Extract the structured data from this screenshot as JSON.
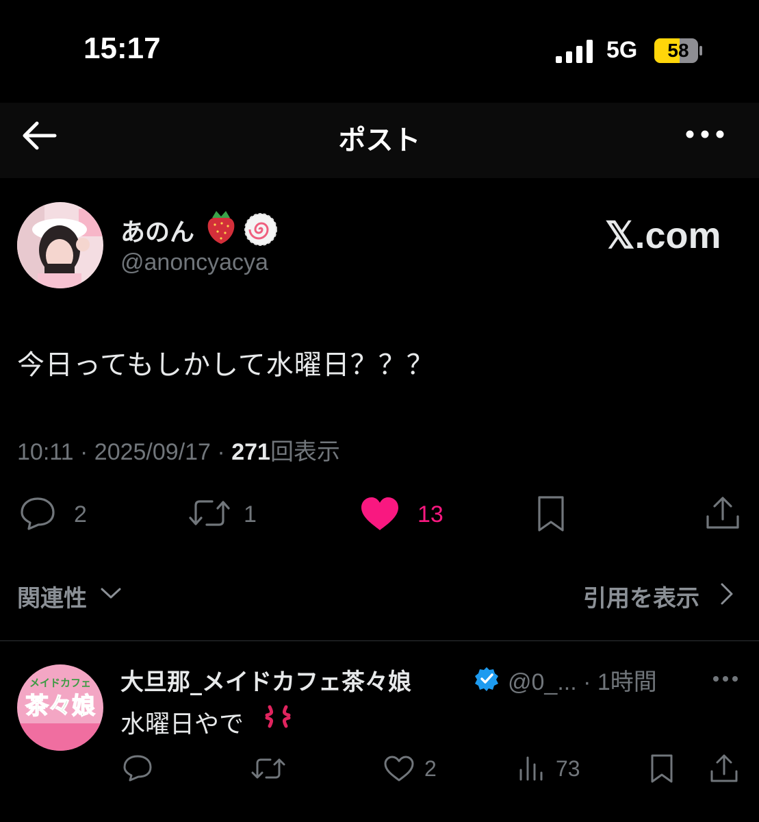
{
  "status": {
    "time": "15:17",
    "network": "5G",
    "battery": "58"
  },
  "nav": {
    "title": "ポスト"
  },
  "post": {
    "author_name": "あのん",
    "handle": "@anoncyacya",
    "brand": "𝕏.com",
    "text": "今日ってもしかして水曜日？？？",
    "time": "10:11",
    "date": "2025/09/17",
    "views": "271",
    "views_label": "回表示",
    "replies": "2",
    "reposts": "1",
    "likes": "13"
  },
  "sections": {
    "relevance": "関連性",
    "quotes": "引用を表示"
  },
  "reply": {
    "author_name": "大旦那_メイドカフェ茶々娘",
    "handle": "@0_...",
    "time": "1時間",
    "text": "水曜日やで",
    "avatar_text": "茶々娘",
    "avatar_top_text": "メイドカフェ",
    "likes": "2",
    "views": "73"
  },
  "colors": {
    "like": "#f91880",
    "verified": "#1d9bf0",
    "battery": "#ffd60a"
  }
}
